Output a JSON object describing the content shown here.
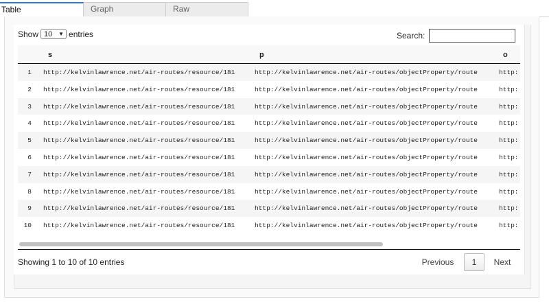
{
  "tabs": [
    {
      "label": "Table",
      "active": true
    },
    {
      "label": "Graph",
      "active": false
    },
    {
      "label": "Raw",
      "active": false
    }
  ],
  "length_control": {
    "show_label": "Show",
    "selected": "10",
    "entries_label": "entries"
  },
  "search": {
    "label": "Search:",
    "value": ""
  },
  "table": {
    "columns": [
      "",
      "s",
      "p",
      "o"
    ],
    "rows": [
      {
        "num": "1",
        "s": "http://kelvinlawrence.net/air-routes/resource/181",
        "p": "http://kelvinlawrence.net/air-routes/objectProperty/route",
        "o": "http:"
      },
      {
        "num": "2",
        "s": "http://kelvinlawrence.net/air-routes/resource/181",
        "p": "http://kelvinlawrence.net/air-routes/objectProperty/route",
        "o": "http:"
      },
      {
        "num": "3",
        "s": "http://kelvinlawrence.net/air-routes/resource/181",
        "p": "http://kelvinlawrence.net/air-routes/objectProperty/route",
        "o": "http:"
      },
      {
        "num": "4",
        "s": "http://kelvinlawrence.net/air-routes/resource/181",
        "p": "http://kelvinlawrence.net/air-routes/objectProperty/route",
        "o": "http:"
      },
      {
        "num": "5",
        "s": "http://kelvinlawrence.net/air-routes/resource/181",
        "p": "http://kelvinlawrence.net/air-routes/objectProperty/route",
        "o": "http:"
      },
      {
        "num": "6",
        "s": "http://kelvinlawrence.net/air-routes/resource/181",
        "p": "http://kelvinlawrence.net/air-routes/objectProperty/route",
        "o": "http:"
      },
      {
        "num": "7",
        "s": "http://kelvinlawrence.net/air-routes/resource/181",
        "p": "http://kelvinlawrence.net/air-routes/objectProperty/route",
        "o": "http:"
      },
      {
        "num": "8",
        "s": "http://kelvinlawrence.net/air-routes/resource/181",
        "p": "http://kelvinlawrence.net/air-routes/objectProperty/route",
        "o": "http:"
      },
      {
        "num": "9",
        "s": "http://kelvinlawrence.net/air-routes/resource/181",
        "p": "http://kelvinlawrence.net/air-routes/objectProperty/route",
        "o": "http:"
      },
      {
        "num": "10",
        "s": "http://kelvinlawrence.net/air-routes/resource/181",
        "p": "http://kelvinlawrence.net/air-routes/objectProperty/route",
        "o": "http:"
      }
    ]
  },
  "footer": {
    "info": "Showing 1 to 10 of 10 entries",
    "previous_label": "Previous",
    "current_page": "1",
    "next_label": "Next"
  },
  "icons": {
    "select_arrow": "chevron-down-icon"
  },
  "colors": {
    "active_tab_accent": "#2e7bd6",
    "header_rule": "#111111"
  }
}
